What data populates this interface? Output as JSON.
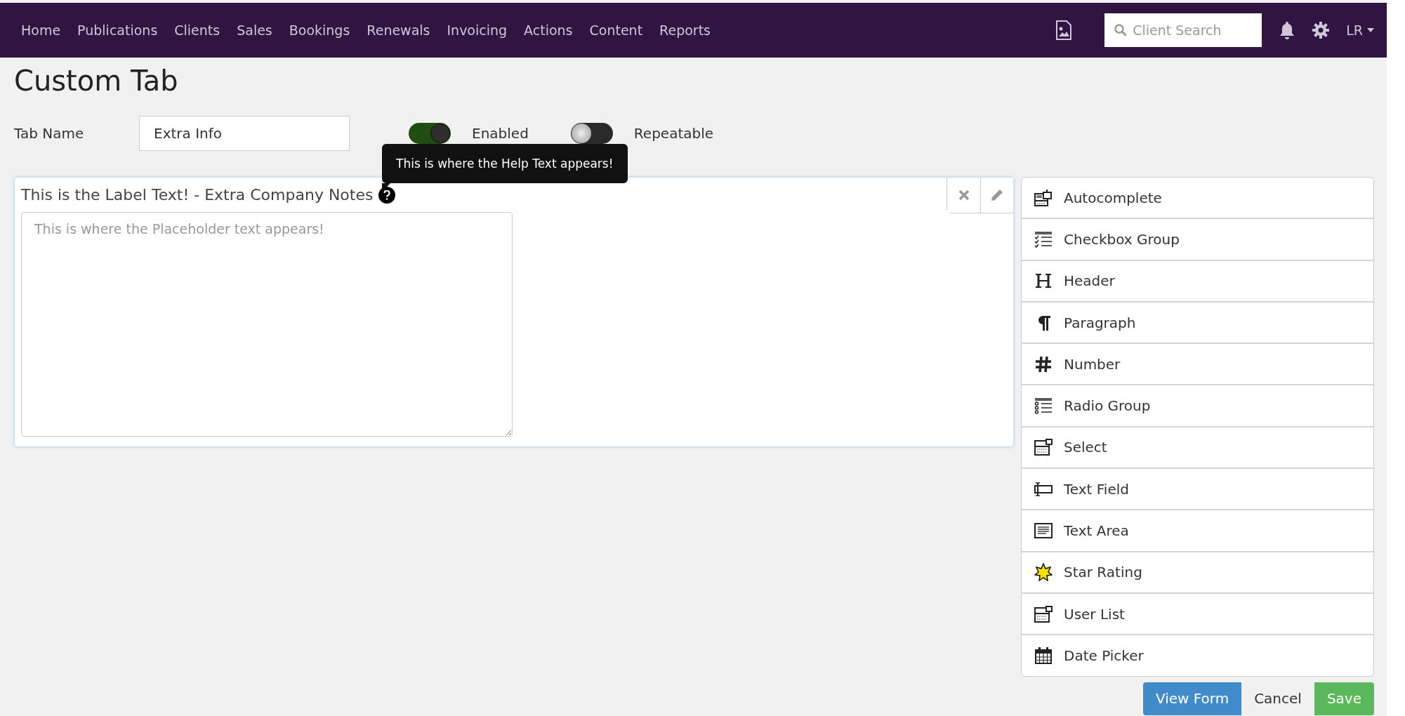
{
  "navbar": {
    "items": [
      "Home",
      "Publications",
      "Clients",
      "Sales",
      "Bookings",
      "Renewals",
      "Invoicing",
      "Actions",
      "Content",
      "Reports"
    ],
    "search": {
      "placeholder": "Client Search"
    },
    "user": "LR"
  },
  "page_title": "Custom Tab",
  "settings": {
    "tab_name_label": "Tab Name",
    "tab_name_value": "Extra Info",
    "toggles": [
      {
        "label": "Enabled",
        "on": true
      },
      {
        "label": "Repeatable",
        "on": false
      }
    ]
  },
  "form_field": {
    "label": "This is the Label Text! - Extra Company Notes",
    "help_tooltip": "This is where the Help Text appears!",
    "placeholder": "This is where the Placeholder text appears!"
  },
  "palette": [
    {
      "kind": "autocomplete",
      "label": "Autocomplete"
    },
    {
      "kind": "checkbox-group",
      "label": "Checkbox Group"
    },
    {
      "kind": "header",
      "label": "Header"
    },
    {
      "kind": "paragraph",
      "label": "Paragraph"
    },
    {
      "kind": "number",
      "label": "Number"
    },
    {
      "kind": "radio-group",
      "label": "Radio Group"
    },
    {
      "kind": "select",
      "label": "Select"
    },
    {
      "kind": "text-field",
      "label": "Text Field"
    },
    {
      "kind": "text-area",
      "label": "Text Area"
    },
    {
      "kind": "star-rating",
      "label": "Star Rating"
    },
    {
      "kind": "user-list",
      "label": "User List"
    },
    {
      "kind": "date-picker",
      "label": "Date Picker"
    }
  ],
  "buttons": [
    {
      "kind": "primary",
      "label": "View Form"
    },
    {
      "kind": "plain",
      "label": "Cancel"
    },
    {
      "kind": "success",
      "label": "Save"
    }
  ]
}
